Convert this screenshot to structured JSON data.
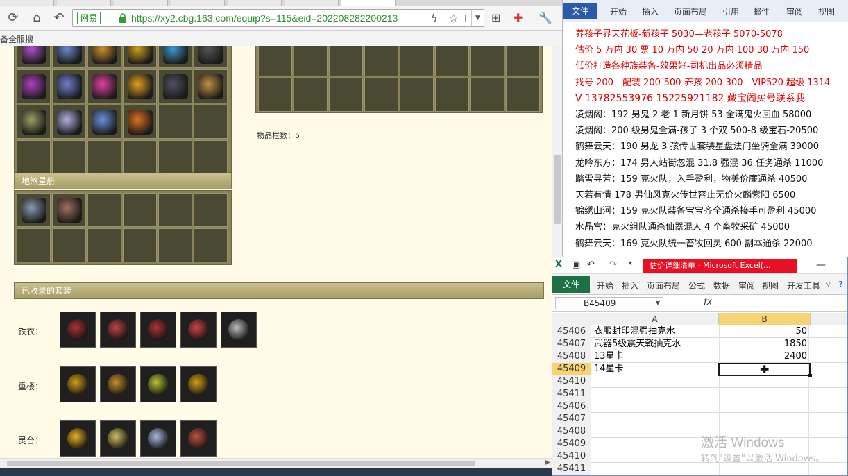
{
  "browser": {
    "site_badge": "网易",
    "url": "https://xy2.cbg.163.com/equip?s=115&eid=202208282200213",
    "bookmarks_label": "备全服搜",
    "item_count_label": "物品栏数：5",
    "section_earth": "地煞星册",
    "section_suits": "已收录的套装",
    "suits": [
      {
        "label": "铁衣：",
        "colors": [
          "#a33",
          "#b44",
          "#a33",
          "#c44",
          "#bbb"
        ]
      },
      {
        "label": "重楼：",
        "colors": [
          "#d4a017",
          "#c8902a",
          "#b8c030",
          "#d4a017"
        ]
      },
      {
        "label": "灵台：",
        "colors": [
          "#e8b020",
          "#d0c060",
          "#a8b8d8",
          "#c05040"
        ]
      }
    ]
  },
  "word": {
    "file_tab": "文件",
    "tabs": [
      "开始",
      "插入",
      "页面布局",
      "引用",
      "邮件",
      "审阅",
      "视图"
    ],
    "lines": [
      {
        "text": "养孩子界天花板-新孩子 5030—老孩子 5070-5078",
        "red": true
      },
      {
        "text": "估价 5 万内 30 票  10 万内 50  20 万内 100  30 万内 150",
        "red": true
      },
      {
        "text": "低价打造各种族装备-效果好-司机出品必须精品",
        "red": true
      },
      {
        "text": "找号 200—配装 200-500-养孩 200-300—VIP520 超级 1314",
        "red": true
      },
      {
        "text": "V 13782553976   15225921182  藏宝阁买号联系我",
        "red": true
      },
      {
        "text": "凌烟阁：192 男鬼 2 老 1 新月饼 53 全满鬼火回血 58000",
        "red": false
      },
      {
        "text": "凌烟阁：200 级男鬼全满-孩子 3 个双 500-8 级宝石-20500",
        "red": false
      },
      {
        "text": "鹤舞云天：190 男龙 3 孩传世套装星盘法门坐骑全满 39000",
        "red": false
      },
      {
        "text": "龙吟东方：174 男人站街忽混 31.8 强混 36 任务通杀 11000",
        "red": false
      },
      {
        "text": "踏雪寻芳：159 克火队，入手盈利，物美价廉通杀 40500",
        "red": false
      },
      {
        "text": "天若有情 178 男仙风克火传世容止无价火麟紫阳 6500",
        "red": false
      },
      {
        "text": "锦绣山河：159 克火队装备宝宝齐全通杀接手可盈利 45000",
        "red": false
      },
      {
        "text": "水晶宫：克火组队通杀仙器混人 4 个畜牧采矿 45000",
        "red": false
      },
      {
        "text": "鹤舞云天：169 克火队统一畜牧回灵 600 副本通杀 22000",
        "red": false
      }
    ]
  },
  "excel": {
    "window_title": "估价详细清单 - Microsoft Excel(...",
    "file_tab": "文件",
    "tabs": [
      "开始",
      "插入",
      "页面布局",
      "公式",
      "数据",
      "审阅",
      "视图",
      "开发工具"
    ],
    "name_box": "B45409",
    "fx": "fx",
    "col_a": "A",
    "col_b": "B",
    "rows": [
      {
        "num": "45406",
        "a": "衣服封印混强抽克水",
        "b": "50"
      },
      {
        "num": "45407",
        "a": "武器5级震天戟抽克水",
        "b": "1850"
      },
      {
        "num": "45408",
        "a": "13星卡",
        "b": "2400"
      },
      {
        "num": "45409",
        "a": "14星卡",
        "b": ""
      },
      {
        "num": "45410",
        "a": "",
        "b": ""
      },
      {
        "num": "45411",
        "a": "",
        "b": ""
      },
      {
        "num": "45406",
        "a": "",
        "b": ""
      },
      {
        "num": "45407",
        "a": "",
        "b": ""
      },
      {
        "num": "45408",
        "a": "",
        "b": ""
      },
      {
        "num": "45409",
        "a": "",
        "b": ""
      },
      {
        "num": "45410",
        "a": "",
        "b": ""
      },
      {
        "num": "45411",
        "a": "",
        "b": ""
      }
    ],
    "watermark_title": "激活 Windows",
    "watermark_sub": "转到\"设置\"以激活 Windows。"
  }
}
